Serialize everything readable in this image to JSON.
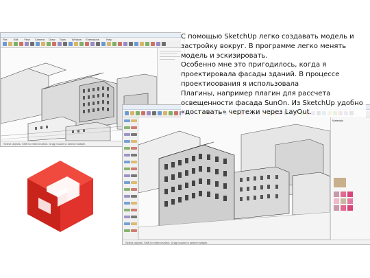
{
  "caption": {
    "lines": [
      "С помощью SketchUp легко создавать модель и застройку вокруг. В программе легко менять модель и эскизировать.",
      "Особенно мне это пригодилось, когда я проектировала фасады зданий. В процессе проектиоования я использовала",
      "Плагины, например плагин для рассчета освещенности фасада SunOn. Из SketchUp удобно «доставать» чертежи через LayOut."
    ]
  },
  "window_top": {
    "menu": [
      "File",
      "Edit",
      "View",
      "Camera",
      "Draw",
      "Tools",
      "Window",
      "Extensions",
      "Help"
    ],
    "status": "Select objects. Shift to extend select. Drag mouse to select multiple."
  },
  "window_bottom": {
    "tray_title": "Materials",
    "status": "Select objects. Shift to extend select. Drag mouse to select multiple."
  },
  "colors": {
    "accent_red": "#e1322b",
    "toolbar_icons": [
      "#3f7fc9",
      "#d2a23b",
      "#5a9b3a",
      "#c04a3a",
      "#7b6bb3",
      "#444444"
    ],
    "swatches": [
      "#c79aa8",
      "#e06a8f",
      "#d9457a",
      "#f0b8c8",
      "#c8b89e",
      "#e27aa0"
    ]
  },
  "icons": {
    "logo": "sketchup-logo-icon"
  }
}
